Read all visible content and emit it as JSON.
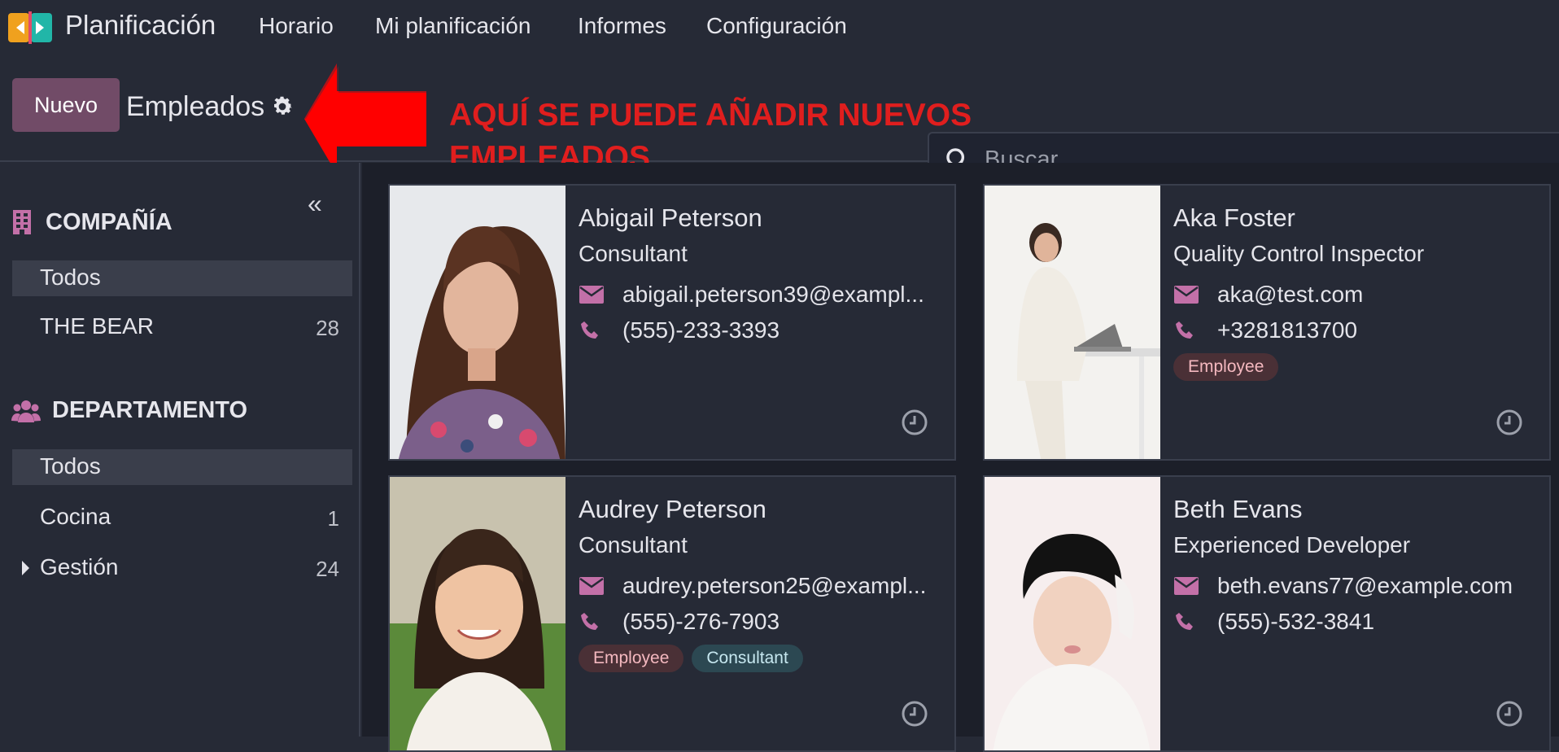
{
  "navbar": {
    "app_name": "Planificación",
    "menu": [
      "Horario",
      "Mi planificación",
      "Informes",
      "Configuración"
    ]
  },
  "control_panel": {
    "new_button": "Nuevo",
    "breadcrumb": "Empleados",
    "search_placeholder": "Buscar..."
  },
  "annotation": {
    "line1": "AQUÍ SE PUEDE AÑADIR NUEVOS",
    "line2": "EMPLEADOS",
    "color": "#e01e1e"
  },
  "sidebar": {
    "collapse_label": "«",
    "company": {
      "title": "COMPAÑÍA",
      "items": [
        {
          "label": "Todos",
          "count": ""
        },
        {
          "label": "THE BEAR",
          "count": "28"
        }
      ]
    },
    "department": {
      "title": "DEPARTAMENTO",
      "items": [
        {
          "label": "Todos",
          "count": ""
        },
        {
          "label": "Cocina",
          "count": "1"
        },
        {
          "label": "Gestión",
          "count": "24"
        }
      ]
    }
  },
  "employees": [
    {
      "name": "Abigail Peterson",
      "job": "Consultant",
      "email": "abigail.peterson39@exampl...",
      "phone": "(555)-233-3393",
      "tags": []
    },
    {
      "name": "Aka Foster",
      "job": "Quality Control Inspector",
      "email": "aka@test.com",
      "phone": "+3281813700",
      "tags": [
        "Employee"
      ]
    },
    {
      "name": "Audrey Peterson",
      "job": "Consultant",
      "email": "audrey.peterson25@exampl...",
      "phone": "(555)-276-7903",
      "tags": [
        "Employee",
        "Consultant"
      ]
    },
    {
      "name": "Beth Evans",
      "job": "Experienced Developer",
      "email": "beth.evans77@example.com",
      "phone": "(555)-532-3841",
      "tags": []
    }
  ],
  "colors": {
    "accent": "#714b67",
    "icon_pink": "#c370a8",
    "background": "#262a36"
  },
  "icons": [
    "app-logo",
    "gear-icon",
    "search-icon",
    "company-icon",
    "department-icon",
    "envelope-icon",
    "phone-icon",
    "clock-icon"
  ]
}
